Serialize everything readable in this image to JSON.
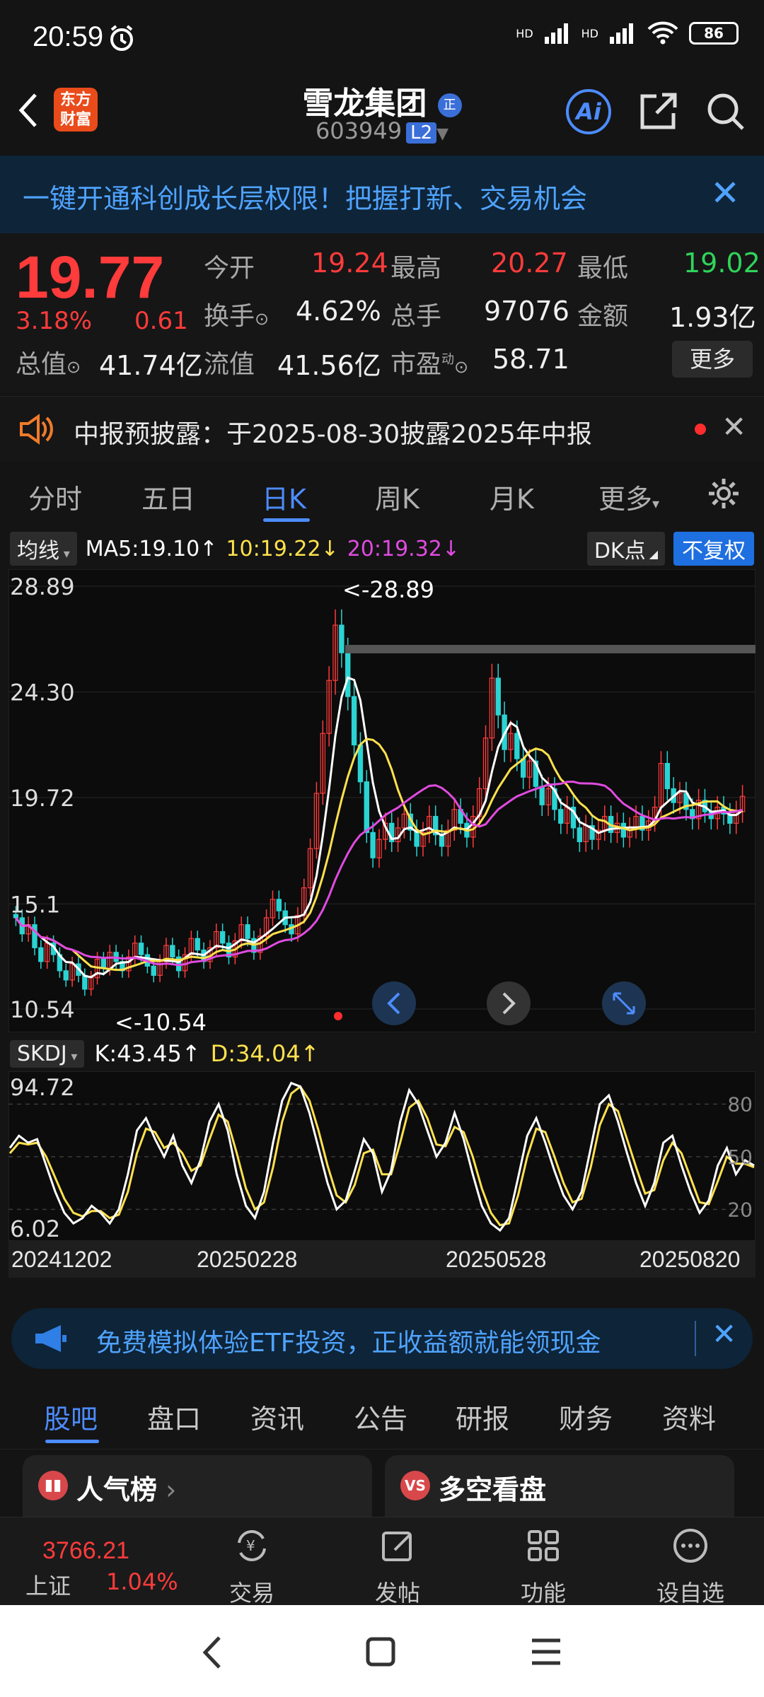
{
  "status_bar": {
    "time": "20:59",
    "signal_1": "HD",
    "signal_2": "HD",
    "battery": "86"
  },
  "header": {
    "back_icon": "back-arrow-icon",
    "logo_line1": "东方",
    "logo_line2": "财富",
    "title": "雪龙集团",
    "verified_badge": "正",
    "stock_code": "603949",
    "level_badge": "L2",
    "ai_label": "Ai"
  },
  "banner": {
    "text": "一键开通科创成长层权限！把握打新、交易机会"
  },
  "quote": {
    "price": "19.77",
    "change_pct": "3.18%",
    "change_amt": "0.61",
    "open_label": "今开",
    "open": "19.24",
    "high_label": "最高",
    "high": "20.27",
    "low_label": "最低",
    "low": "19.02",
    "turnover_label": "换手",
    "turnover": "4.62%",
    "volume_label": "总手",
    "volume": "97076",
    "amount_label": "金额",
    "amount": "1.93亿",
    "mktcap_label": "总值",
    "mktcap": "41.74亿",
    "float_label": "流值",
    "float_cap": "41.56亿",
    "pe_label": "市盈",
    "pe_sup": "动",
    "pe": "58.71",
    "more_label": "更多"
  },
  "notice": {
    "text": "中报预披露：于2025-08-30披露2025年中报"
  },
  "chart_tabs": {
    "items": [
      "分时",
      "五日",
      "日K",
      "周K",
      "月K",
      "更多"
    ],
    "active": 2
  },
  "chart_toolbar": {
    "indicator": "均线",
    "ma5": "MA5:19.10",
    "ma10": "10:19.22",
    "ma20": "20:19.32",
    "dk_label": "DK点",
    "adjust_label": "不复权"
  },
  "chart_data": [
    {
      "type": "candlestick",
      "y_labels": [
        "28.89",
        "24.30",
        "19.72",
        "15.1",
        "10.54"
      ],
      "ylim": [
        10.54,
        28.89
      ],
      "max_label": "<-28.89",
      "min_label": "<-10.54",
      "series": [
        {
          "name": "MA5",
          "color": "#ffffff"
        },
        {
          "name": "MA10",
          "color": "#ffe14d"
        },
        {
          "name": "MA20",
          "color": "#e04be0"
        }
      ],
      "close": [
        14.5,
        13.8,
        14.2,
        13.2,
        12.6,
        13.4,
        12.9,
        12.2,
        11.8,
        12.5,
        12.0,
        11.4,
        11.9,
        12.7,
        12.3,
        13.0,
        12.6,
        12.2,
        12.8,
        13.4,
        12.9,
        12.4,
        12.0,
        12.6,
        13.3,
        12.8,
        12.2,
        12.9,
        13.6,
        13.1,
        12.6,
        13.2,
        13.9,
        13.4,
        12.8,
        13.5,
        14.2,
        13.6,
        13.0,
        13.7,
        14.5,
        15.3,
        14.8,
        14.2,
        13.8,
        14.6,
        15.8,
        17.5,
        19.9,
        22.5,
        24.8,
        27.2,
        26.0,
        24.1,
        22.0,
        20.4,
        18.2,
        17.1,
        17.9,
        18.6,
        17.8,
        18.4,
        19.0,
        18.3,
        17.6,
        18.2,
        18.9,
        18.1,
        17.6,
        18.3,
        19.2,
        18.6,
        18.0,
        18.9,
        20.1,
        22.3,
        24.9,
        23.3,
        21.8,
        22.5,
        21.4,
        20.6,
        21.3,
        20.2,
        19.4,
        20.1,
        19.2,
        18.6,
        19.3,
        18.4,
        17.8,
        18.5,
        17.9,
        18.3,
        18.9,
        18.2,
        18.6,
        18.0,
        18.4,
        18.9,
        18.3,
        18.7,
        19.3,
        21.2,
        20.1,
        19.5,
        19.9,
        19.2,
        18.8,
        19.6,
        19.1,
        18.8,
        19.3,
        19.0,
        18.6,
        19.1,
        19.77
      ],
      "volume": []
    },
    {
      "type": "line",
      "title": "SKDJ",
      "y_labels": [
        "94.72",
        "6.02"
      ],
      "right_labels": [
        "80",
        "50",
        "20"
      ],
      "ylim": [
        6.02,
        94.72
      ],
      "x_labels": [
        "20241202",
        "20250228",
        "20250528",
        "20250820"
      ],
      "series": [
        {
          "name": "K",
          "value_label": "K:43.45",
          "color": "#ffffff",
          "values": [
            55,
            62,
            58,
            60,
            45,
            30,
            18,
            12,
            15,
            22,
            18,
            12,
            20,
            40,
            65,
            72,
            60,
            50,
            62,
            45,
            35,
            48,
            70,
            80,
            65,
            40,
            22,
            15,
            30,
            58,
            82,
            92,
            90,
            75,
            55,
            35,
            20,
            25,
            42,
            60,
            52,
            30,
            42,
            70,
            88,
            80,
            65,
            50,
            58,
            75,
            60,
            40,
            22,
            12,
            8,
            15,
            38,
            62,
            72,
            58,
            42,
            28,
            20,
            30,
            55,
            80,
            85,
            70,
            52,
            35,
            22,
            35,
            58,
            62,
            45,
            30,
            18,
            25,
            45,
            55,
            40,
            48,
            45
          ]
        },
        {
          "name": "D",
          "value_label": "D:34.04",
          "color": "#ffe14d",
          "values": [
            52,
            58,
            57,
            58,
            50,
            38,
            26,
            18,
            16,
            19,
            19,
            15,
            17,
            30,
            52,
            66,
            64,
            55,
            58,
            52,
            42,
            45,
            60,
            74,
            70,
            52,
            32,
            20,
            24,
            44,
            70,
            86,
            90,
            82,
            65,
            45,
            28,
            24,
            34,
            52,
            54,
            40,
            40,
            58,
            78,
            82,
            72,
            57,
            56,
            67,
            64,
            50,
            32,
            18,
            11,
            12,
            28,
            50,
            66,
            64,
            50,
            35,
            24,
            26,
            44,
            68,
            80,
            76,
            60,
            44,
            29,
            31,
            48,
            58,
            52,
            38,
            24,
            23,
            36,
            50,
            46,
            46,
            44
          ]
        }
      ]
    }
  ],
  "kdj_tool": {
    "indicator": "SKDJ",
    "k_label": "K:43.45",
    "d_label": "D:34.04"
  },
  "promo": {
    "text": "免费模拟体验ETF投资，正收益额就能领现金"
  },
  "bottom_tabs": {
    "items": [
      "股吧",
      "盘口",
      "资讯",
      "公告",
      "研报",
      "财务",
      "资料"
    ],
    "active": 0
  },
  "cards": {
    "left": "人气榜",
    "right": "多空看盘",
    "left_icon": "bar-chart-icon",
    "right_icon": "vs-icon"
  },
  "bottom_nav": {
    "index_value": "3766.21",
    "index_name": "上证",
    "index_pct": "1.04%",
    "items": [
      "交易",
      "发帖",
      "功能",
      "设自选"
    ]
  },
  "colors": {
    "up": "#ff3b3b",
    "down": "#2fd35a",
    "accent": "#4d8cff",
    "banner_bg": "#0e2438"
  }
}
